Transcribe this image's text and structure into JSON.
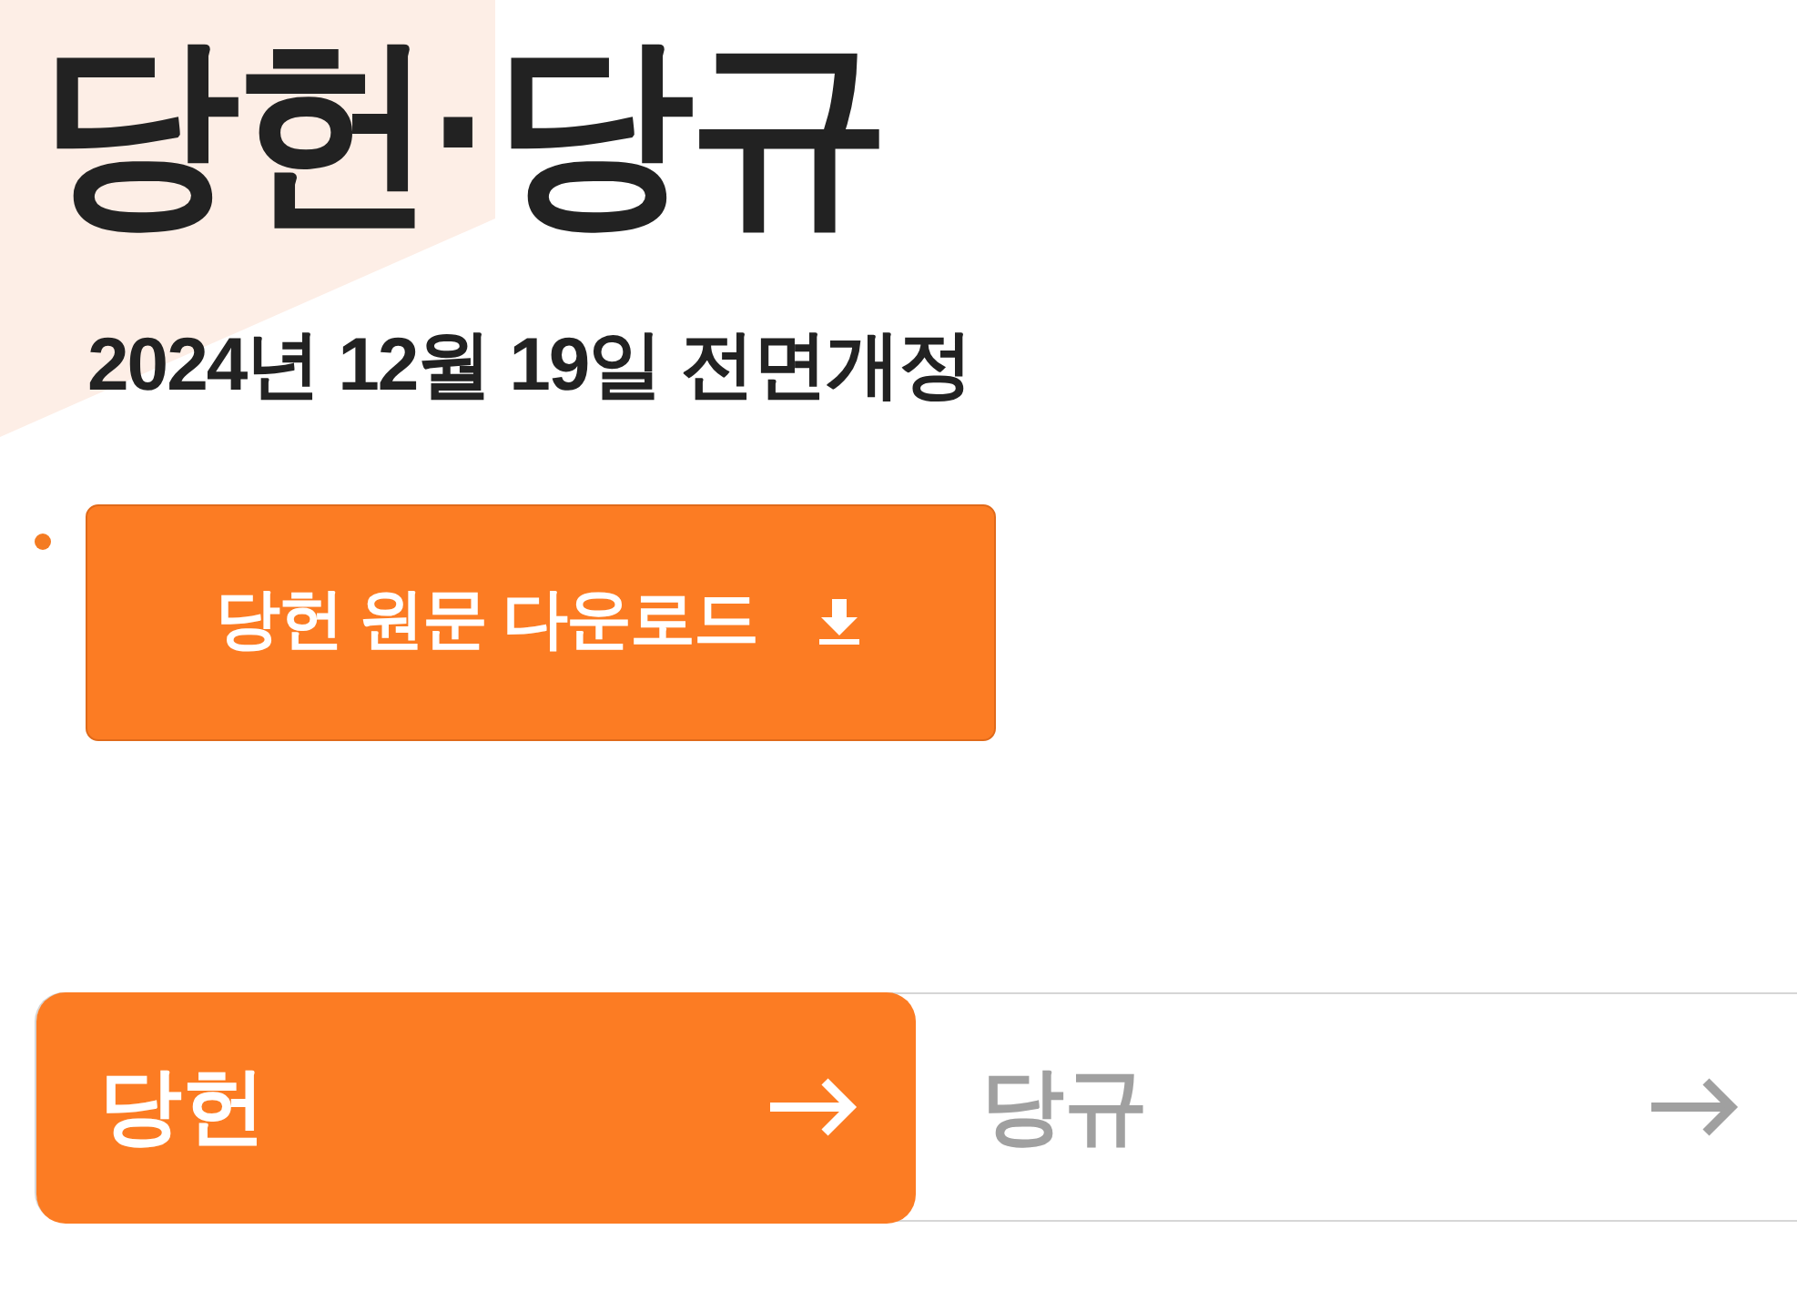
{
  "title": "당헌·당규",
  "subtitle": "2024년 12월 19일 전면개정",
  "download_button": {
    "label": "당헌 원문 다운로드"
  },
  "tabs": [
    {
      "label": "당헌",
      "selected": true
    },
    {
      "label": "당규",
      "selected": false
    }
  ]
}
